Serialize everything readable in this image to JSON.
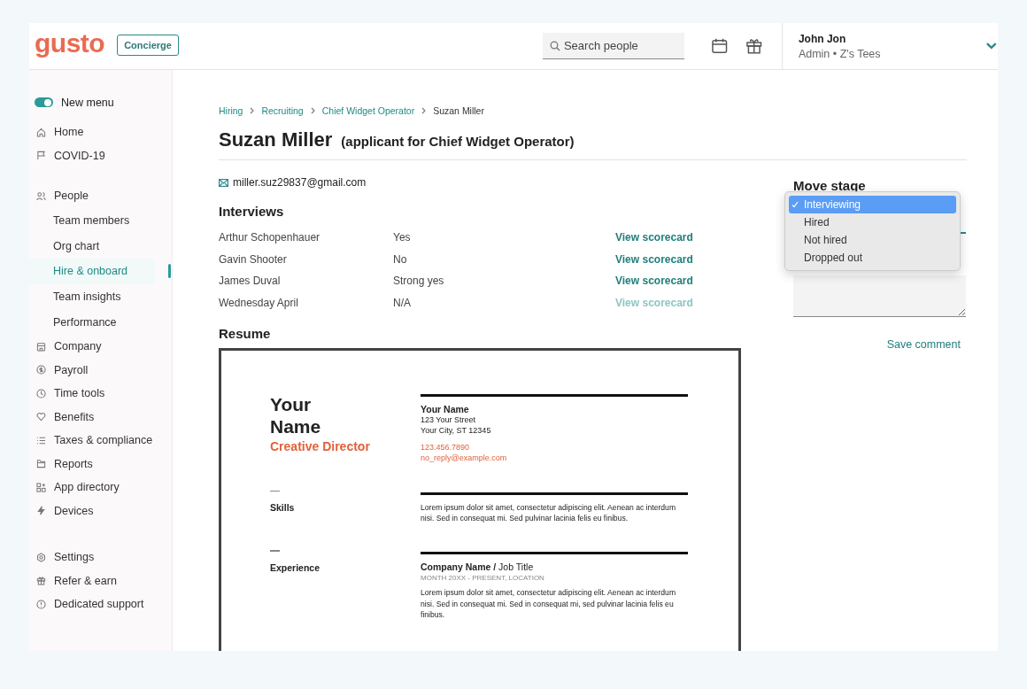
{
  "header": {
    "logo": "gusto",
    "concierge": "Concierge",
    "search": {
      "placeholder": "Search people"
    },
    "user": {
      "name": "John Jon",
      "role": "Admin • Z's Tees"
    }
  },
  "sidebar": {
    "toggle": {
      "label": "New menu",
      "on": true
    },
    "groups": [
      [
        {
          "label": "Home",
          "kind": "main",
          "selected": false
        },
        {
          "label": "COVID-19",
          "kind": "main",
          "selected": false
        }
      ],
      [
        {
          "label": "People",
          "kind": "main",
          "selected": false
        },
        {
          "label": "Team members",
          "kind": "sub",
          "selected": false
        },
        {
          "label": "Org chart",
          "kind": "sub",
          "selected": false
        },
        {
          "label": "Hire & onboard",
          "kind": "sub",
          "selected": true
        },
        {
          "label": "Team insights",
          "kind": "sub",
          "selected": false
        },
        {
          "label": "Performance",
          "kind": "sub",
          "selected": false
        },
        {
          "label": "Company",
          "kind": "main",
          "selected": false
        },
        {
          "label": "Payroll",
          "kind": "main",
          "selected": false
        },
        {
          "label": "Time tools",
          "kind": "main",
          "selected": false
        },
        {
          "label": "Benefits",
          "kind": "main",
          "selected": false
        },
        {
          "label": "Taxes & compliance",
          "kind": "main",
          "selected": false
        },
        {
          "label": "Reports",
          "kind": "main",
          "selected": false
        },
        {
          "label": "App directory",
          "kind": "main",
          "selected": false
        },
        {
          "label": "Devices",
          "kind": "main",
          "selected": false
        }
      ],
      [
        {
          "label": "Settings",
          "kind": "main",
          "selected": false
        },
        {
          "label": "Refer & earn",
          "kind": "main",
          "selected": false
        },
        {
          "label": "Dedicated support",
          "kind": "main",
          "selected": false
        }
      ]
    ]
  },
  "breadcrumbs": [
    "Hiring",
    "Recruiting",
    "Chief Widget Operator",
    "Suzan Miller"
  ],
  "title": "Suzan Miller",
  "subtitle": "(applicant for Chief Widget Operator)",
  "email": "miller.suz29837@gmail.com",
  "interviews": {
    "heading": "Interviews",
    "rows": [
      {
        "name": "Arthur Schopenhauer",
        "verdict": "Yes",
        "link": "View scorecard",
        "disabled": false
      },
      {
        "name": "Gavin Shooter",
        "verdict": "No",
        "link": "View scorecard",
        "disabled": false
      },
      {
        "name": "James Duval",
        "verdict": "Strong yes",
        "link": "View scorecard",
        "disabled": false
      },
      {
        "name": "Wednesday April",
        "verdict": "N/A",
        "link": "View scorecard",
        "disabled": true
      }
    ]
  },
  "resume": {
    "heading": "Resume",
    "name_lines": [
      "Your",
      "Name"
    ],
    "role": "Creative Director",
    "contact_name": "Your Name",
    "address": [
      "123 Your Street",
      "Your City, ST 12345"
    ],
    "phone": "123.456.7890",
    "contact_email": "no_reply@example.com",
    "sections": [
      {
        "label": "Skills",
        "text": "Lorem ipsum dolor sit amet, consectetur adipiscing elit. Aenean ac interdum nisi. Sed in consequat mi. Sed pulvinar lacinia felis eu finibus."
      },
      {
        "label": "Experience",
        "job": "**Company Name /** Job Title",
        "meta": "MONTH 20XX - PRESENT,  LOCATION",
        "text": "Lorem ipsum dolor sit amet, consectetur adipiscing elit. Aenean ac interdum nisi. Sed in consequat mi. Sed in consequat mi, sed pulvinar lacinia felis eu finibus."
      }
    ]
  },
  "stage": {
    "heading": "Move stage",
    "options": [
      {
        "label": "Interviewing",
        "selected": true
      },
      {
        "label": "Hired",
        "selected": false
      },
      {
        "label": "Not hired",
        "selected": false
      },
      {
        "label": "Dropped out",
        "selected": false
      }
    ],
    "save": "Save comment"
  }
}
